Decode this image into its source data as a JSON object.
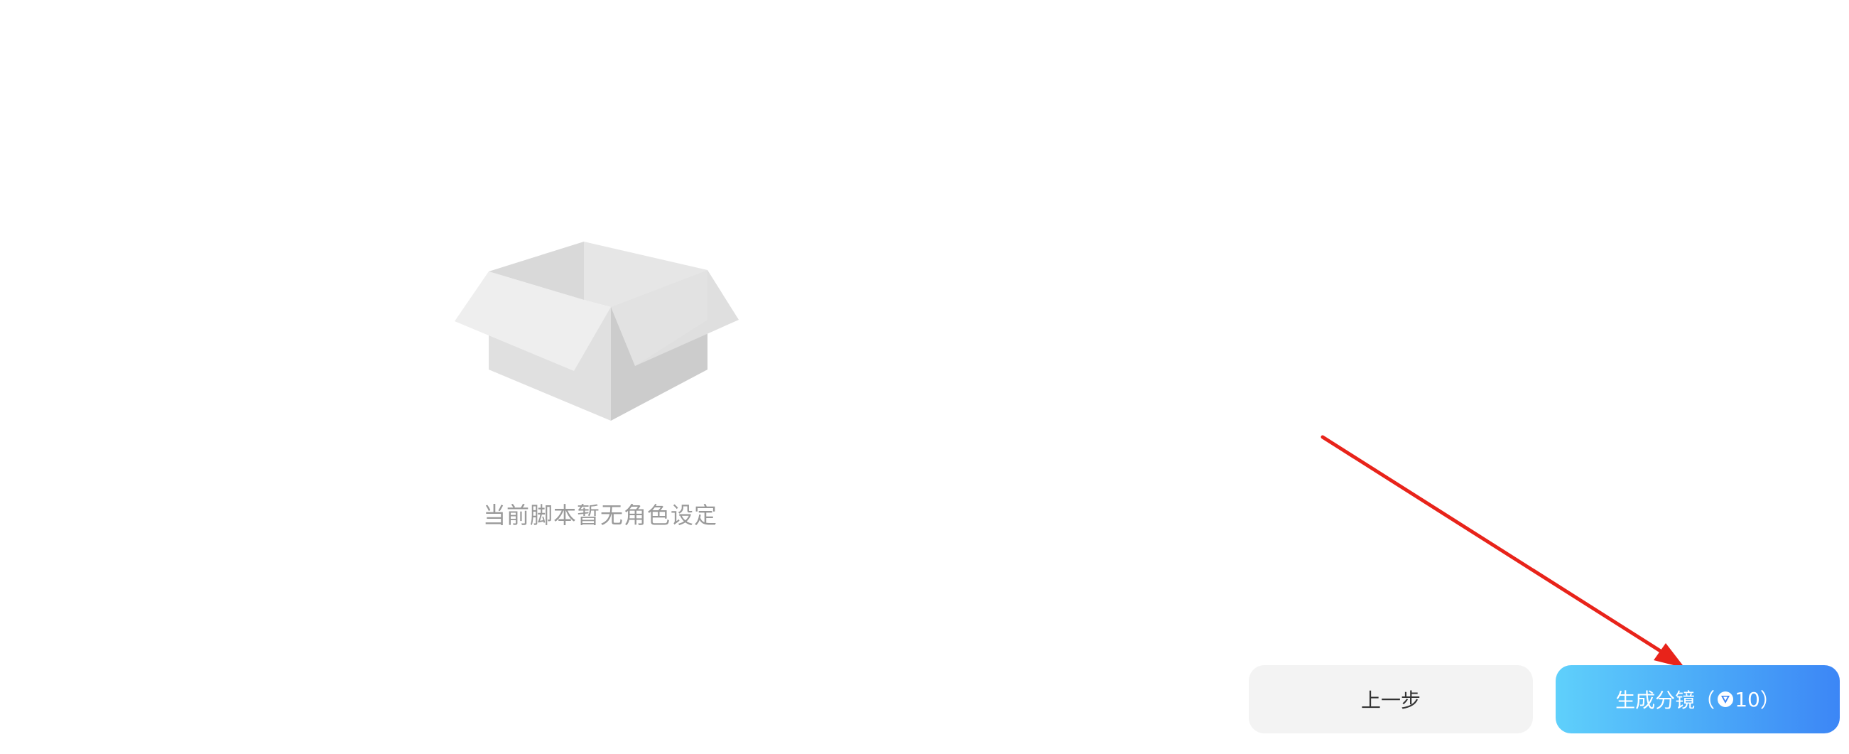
{
  "empty_state": {
    "icon": "open-box-icon",
    "message": "当前脚本暂无角色设定"
  },
  "footer": {
    "prev_label": "上一步",
    "generate_label": "生成分镜",
    "cost_open": "（",
    "cost_icon": "token-coin-icon",
    "cost_value": "10",
    "cost_close": "）"
  },
  "colors": {
    "accent_start": "#5fd0fb",
    "accent_end": "#3c86f6",
    "annotation_arrow": "#e8231a",
    "empty_text": "#9a9a9a"
  }
}
